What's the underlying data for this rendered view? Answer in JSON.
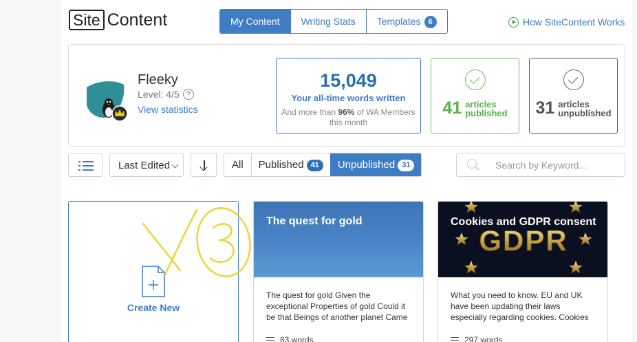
{
  "logo": {
    "boxed": "Site",
    "rest": "Content"
  },
  "tabs": [
    {
      "label": "My Content",
      "active": true
    },
    {
      "label": "Writing Stats",
      "active": false
    },
    {
      "label": "Templates",
      "count": "6",
      "active": false
    }
  ],
  "how_link": "How SiteContent Works",
  "user": {
    "name": "Fleeky",
    "level": "Level: 4/5",
    "help": "?",
    "view_stats": "View statistics"
  },
  "words": {
    "total": "15,049",
    "label": "Your all-time words written",
    "more_prefix": "And more than ",
    "more_pct": "96%",
    "more_suffix": " of WA Members this month"
  },
  "published": {
    "count": "41",
    "line1": "articles",
    "line2": "published"
  },
  "unpublished": {
    "count": "31",
    "line1": "articles",
    "line2": "unpublished"
  },
  "sort": {
    "label": "Last Edited"
  },
  "filters": {
    "all": "All",
    "published": "Published",
    "published_count": "41",
    "unpublished": "Unpublished",
    "unpublished_count": "31"
  },
  "search": {
    "placeholder": "Search by Keyword..."
  },
  "create": {
    "label": "Create New"
  },
  "cards": [
    {
      "title": "The quest for gold",
      "excerpt": "The quest for gold Given the exceptional Properties of gold Could it be that Beings of another planet Came",
      "words": "83 words"
    },
    {
      "title": "Cookies and GDPR consent",
      "image_text": "GDPR",
      "excerpt": "What you need to know. EU and UK have been updating their laws especially regarding cookies. Cookies",
      "words": "297 words"
    }
  ],
  "colors": {
    "accent": "#3f7cc4",
    "green": "#5bb24a",
    "annotation": "#f2d233"
  }
}
